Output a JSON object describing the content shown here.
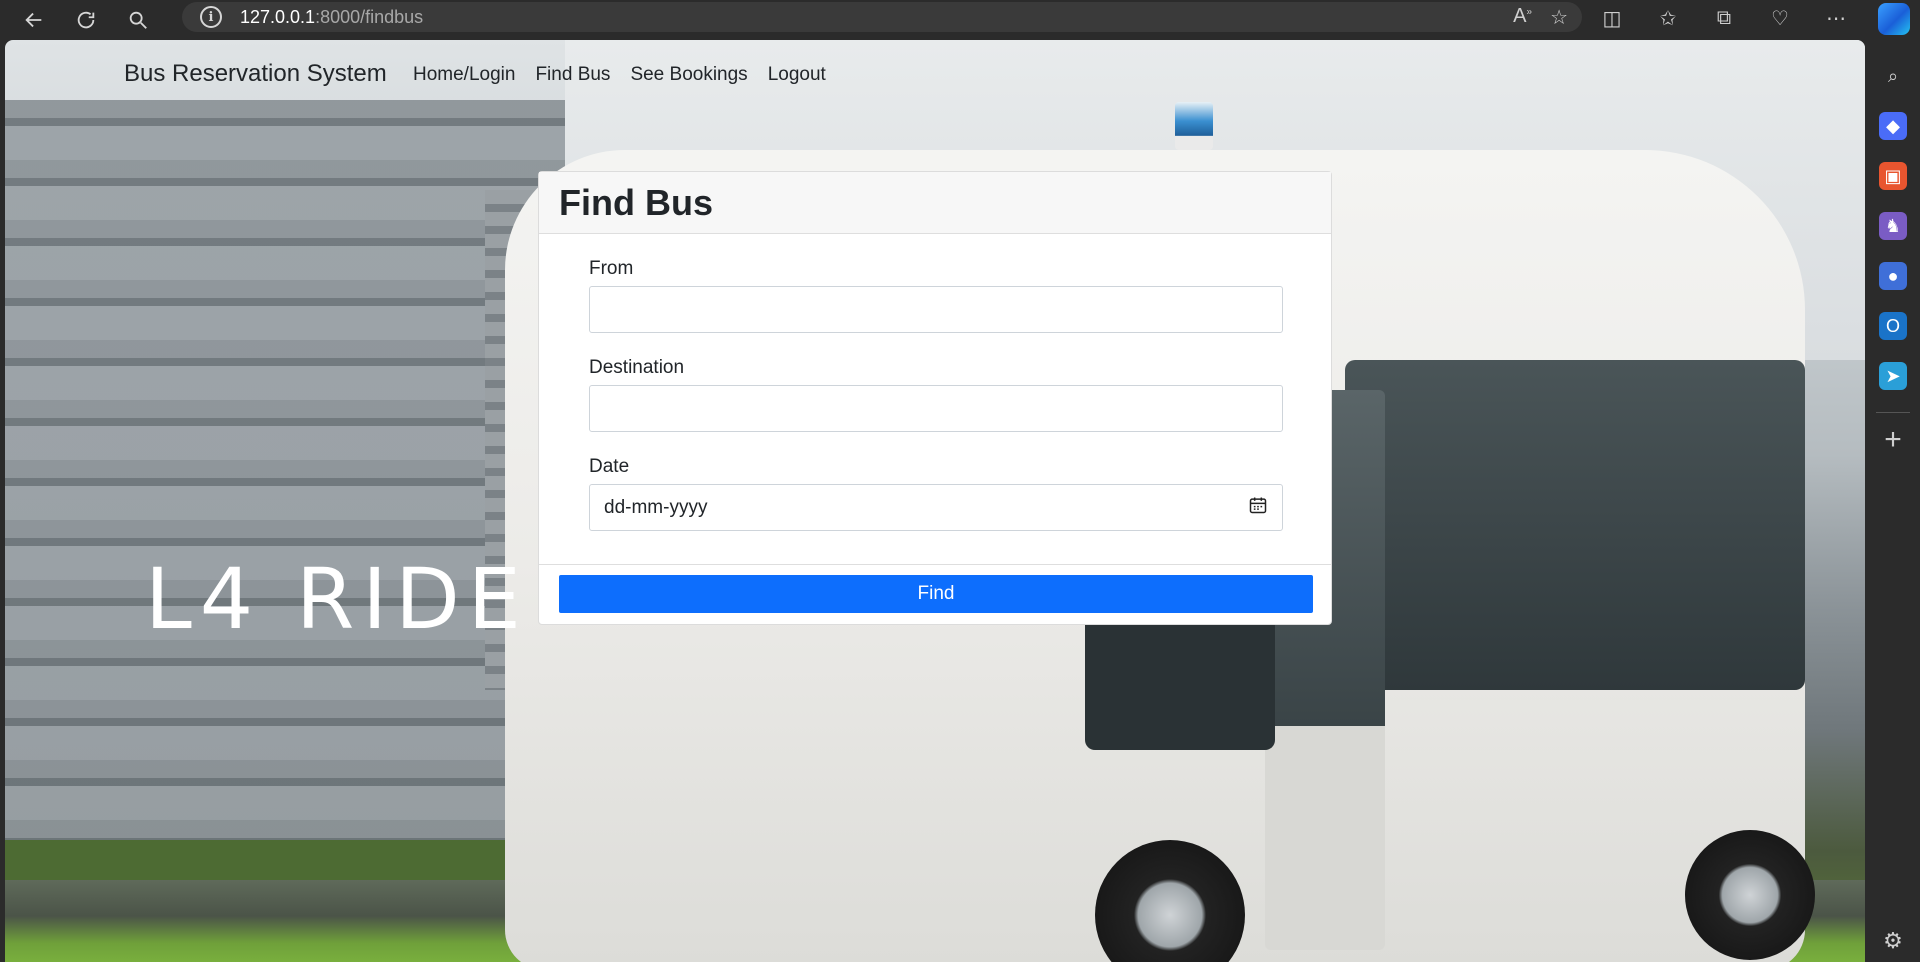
{
  "browser": {
    "url_host": "127.0.0.1",
    "url_path": ":8000/findbus"
  },
  "navbar": {
    "brand": "Bus Reservation System",
    "links": [
      "Home/Login",
      "Find Bus",
      "See Bookings",
      "Logout"
    ]
  },
  "background": {
    "logo_text": "L4 RIDE"
  },
  "form": {
    "title": "Find Bus",
    "from_label": "From",
    "from_value": "",
    "destination_label": "Destination",
    "destination_value": "",
    "date_label": "Date",
    "date_placeholder": "dd-mm-yyyy",
    "submit_label": "Find"
  },
  "colors": {
    "primary_button": "#0d6efd",
    "browser_chrome": "#2b2b2b"
  }
}
